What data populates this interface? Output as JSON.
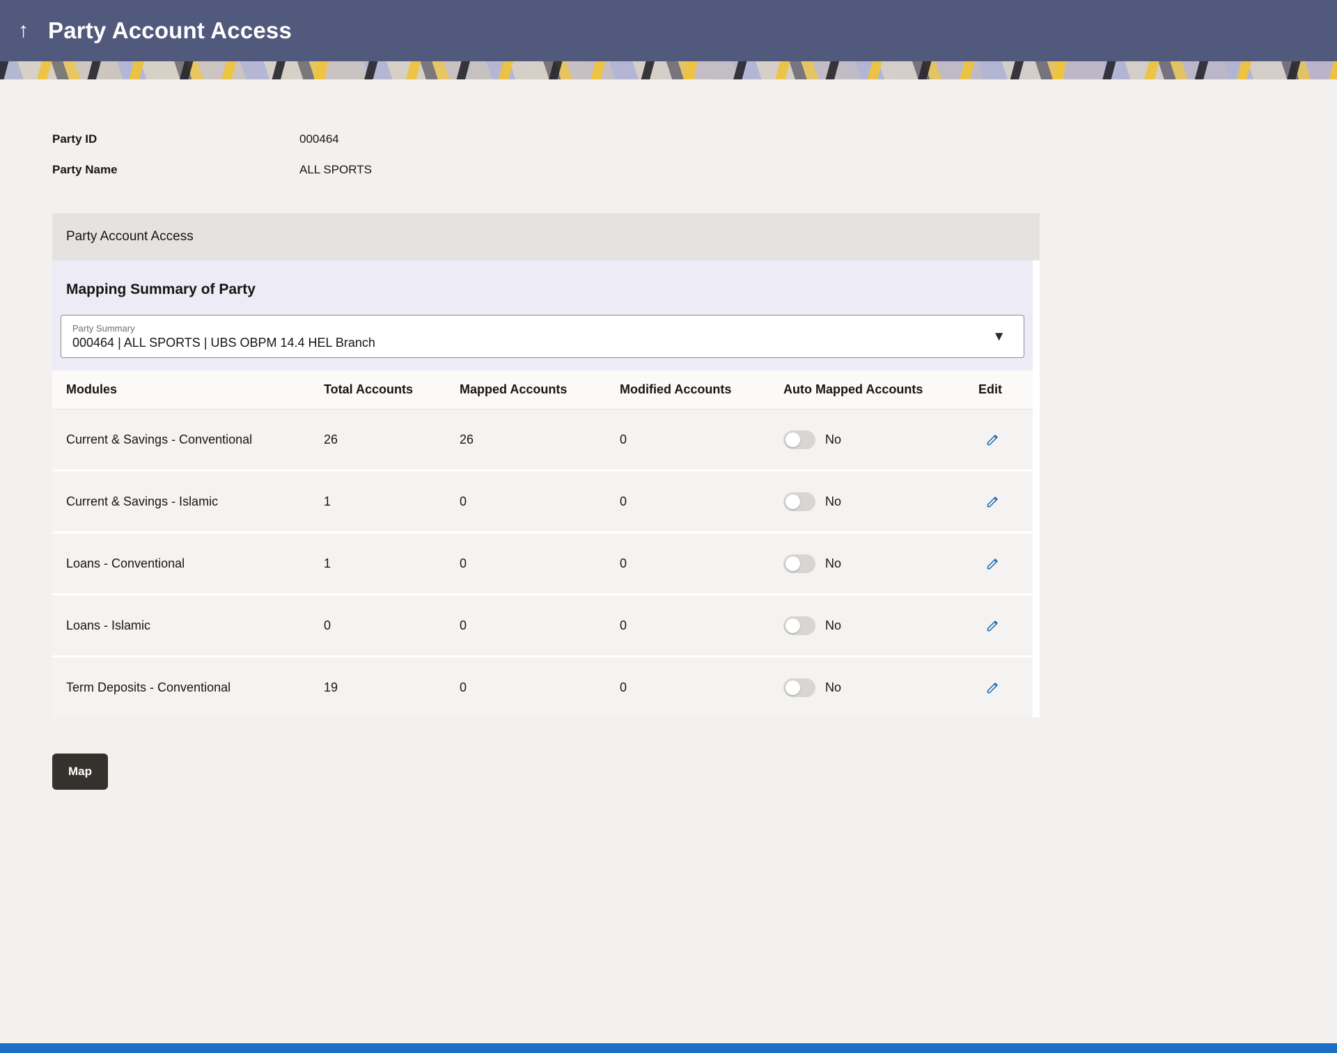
{
  "header": {
    "title": "Party Account Access",
    "back_glyph": "↑"
  },
  "party": {
    "id_label": "Party ID",
    "id_value": "000464",
    "name_label": "Party Name",
    "name_value": "ALL SPORTS"
  },
  "panel": {
    "title": "Party Account Access",
    "section_title": "Mapping Summary of Party",
    "party_summary": {
      "label": "Party Summary",
      "value": "000464 | ALL SPORTS | UBS OBPM 14.4 HEL Branch",
      "chevron_glyph": "▼"
    }
  },
  "table": {
    "columns": [
      "Modules",
      "Total Accounts",
      "Mapped Accounts",
      "Modified Accounts",
      "Auto Mapped Accounts",
      "Edit"
    ],
    "rows": [
      {
        "module": "Current & Savings - Conventional",
        "total": "26",
        "mapped": "26",
        "modified": "0",
        "auto_mapped": "No"
      },
      {
        "module": "Current & Savings - Islamic",
        "total": "1",
        "mapped": "0",
        "modified": "0",
        "auto_mapped": "No"
      },
      {
        "module": "Loans - Conventional",
        "total": "1",
        "mapped": "0",
        "modified": "0",
        "auto_mapped": "No"
      },
      {
        "module": "Loans - Islamic",
        "total": "0",
        "mapped": "0",
        "modified": "0",
        "auto_mapped": "No"
      },
      {
        "module": "Term Deposits - Conventional",
        "total": "19",
        "mapped": "0",
        "modified": "0",
        "auto_mapped": "No"
      }
    ]
  },
  "actions": {
    "map_label": "Map"
  },
  "colors": {
    "header_bg": "#515a7c",
    "link_blue": "#1767b3",
    "section_lavender": "#edebf5",
    "button_dark": "#35322d",
    "bottom_bar_blue": "#1b6fc5"
  }
}
